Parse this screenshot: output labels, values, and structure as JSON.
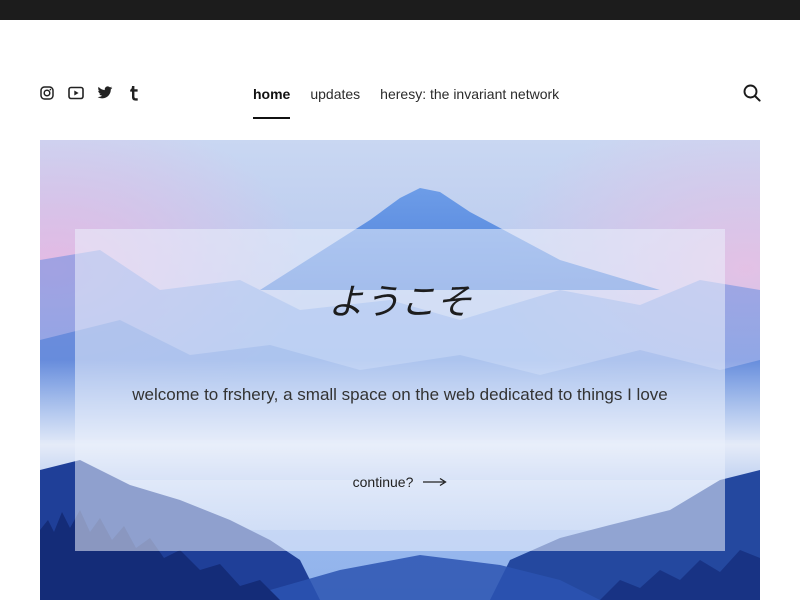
{
  "social": {
    "icons": [
      "instagram-icon",
      "youtube-icon",
      "twitter-icon",
      "tumblr-icon"
    ]
  },
  "nav": {
    "items": [
      {
        "label": "home",
        "active": true
      },
      {
        "label": "updates",
        "active": false
      },
      {
        "label": "heresy: the invariant network",
        "active": false
      }
    ]
  },
  "search": {
    "icon": "search-icon"
  },
  "hero": {
    "title": "ようこそ",
    "subtitle": "welcome to frshery, a small space on the web dedicated to things I love",
    "cta_label": "continue?",
    "cta_icon": "long-arrow-right-icon"
  },
  "colors": {
    "topbar": "#1c1c1c",
    "text": "#2b2b2b",
    "sky": "#9cbdf0",
    "mountain": "#3f76d8"
  }
}
